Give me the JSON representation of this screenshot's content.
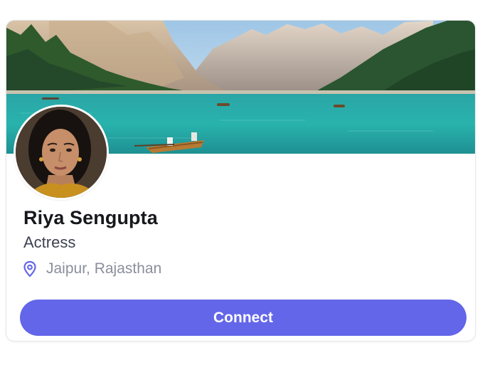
{
  "profile": {
    "name": "Riya Sengupta",
    "role": "Actress",
    "location": "Jaipur, Rajasthan"
  },
  "actions": {
    "connect_label": "Connect"
  },
  "icons": {
    "location": "map-pin-icon"
  },
  "colors": {
    "accent": "#6366e8",
    "name_text": "#16181d",
    "role_text": "#3d4250",
    "muted_text": "#8a8f9c",
    "card_border": "#e6e7eb"
  }
}
